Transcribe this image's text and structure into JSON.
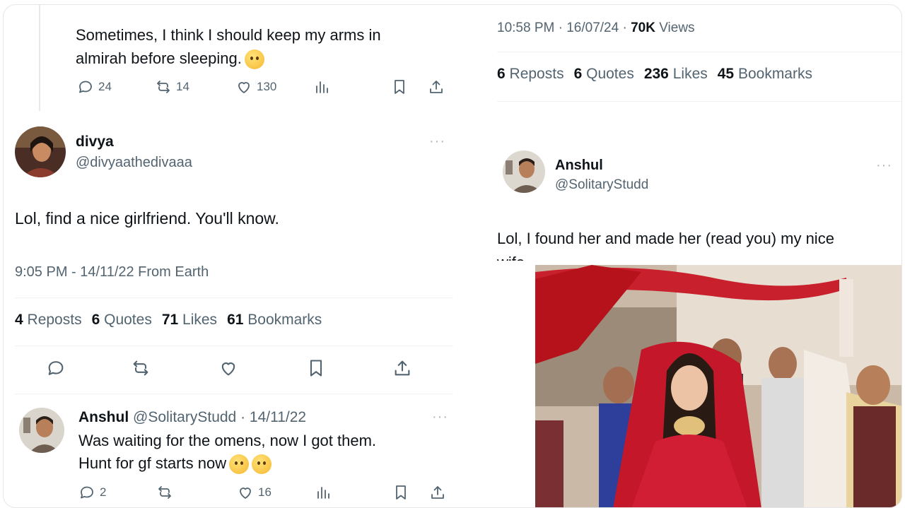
{
  "left": {
    "top_tweet": {
      "text_line1": "Sometimes, I think I should keep my arms in",
      "text_line2": "almirah before sleeping.",
      "replies": "24",
      "reposts": "14",
      "likes": "130"
    },
    "divya": {
      "name": "divya",
      "handle": "@divyaathedivaaa",
      "more": "···",
      "text": "Lol, find a nice girlfriend. You'll know.",
      "meta": "9:05 PM - 14/11/22 From Earth",
      "reposts_count": "4",
      "reposts_label": "Reposts",
      "quotes_count": "6",
      "quotes_label": "Quotes",
      "likes_count": "71",
      "likes_label": "Likes",
      "bookmarks_count": "61",
      "bookmarks_label": "Bookmarks"
    },
    "reply": {
      "name": "Anshul",
      "handle_date": "@SolitaryStudd · 14/11/22",
      "more": "···",
      "text_line1": "Was waiting for the omens, now I got them.",
      "text_line2": "Hunt for gf starts now",
      "replies": "2",
      "likes": "16"
    }
  },
  "right": {
    "meta_time": "10:58 PM · 16/07/24 ·",
    "views_count": "70K",
    "views_label": "Views",
    "reposts_count": "6",
    "reposts_label": "Reposts",
    "quotes_count": "6",
    "quotes_label": "Quotes",
    "likes_count": "236",
    "likes_label": "Likes",
    "bookmarks_count": "45",
    "bookmarks_label": "Bookmarks",
    "anshul": {
      "name": "Anshul",
      "handle": "@SolitaryStudd",
      "more": "···",
      "text_line1": "Lol, I found her and made her (read you) my nice",
      "text_line2": "wife"
    }
  },
  "icons": [
    "reply-icon",
    "repost-icon",
    "like-icon",
    "views-icon",
    "bookmark-icon",
    "share-icon"
  ],
  "colors": {
    "text": "#0f1419",
    "muted": "#536471",
    "bride_red": "#c8202c"
  }
}
